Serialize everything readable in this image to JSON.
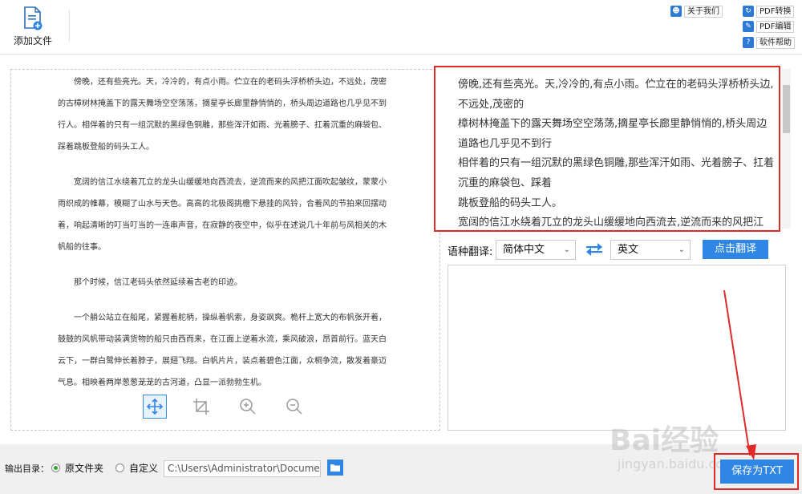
{
  "toolbar": {
    "add_file_label": "添加文件",
    "about_label": "关于我们",
    "pdf_convert_label": "PDF转换",
    "pdf_edit_label": "PDF编辑",
    "help_label": "软件帮助"
  },
  "preview": {
    "paragraphs": [
      "傍晚，还有些亮光。天，冷冷的，有点小雨。伫立在的老码头浮桥桥头边，不远处，茂密的古樟树林掩盖下的露天舞场空空荡荡，摘星亭长廊里静悄悄的，桥头周边道路也几乎见不到行人。相伴着的只有一组沉默的黑绿色铜雕，那些浑汗如雨、光着膀子、扛着沉重的麻袋包、踩着跳板登船的码头工人。",
      "宽阔的信江水绕着兀立的龙头山缓缓地向西流去，逆流而来的风把江面吹起皱纹，蒙蒙小雨织成的帷幕，模糊了山水与天色。高高的北极阁挑檐下悬挂的风铃，合着风的节拍来回摆动着，响起清晰的叮当叮当的一连串声音，在寂静的夜空中，似乎在述说几十年前与风相关的木帆船的往事。",
      "那个时候，信江老码头依然延续着古老的印迹。",
      "一个艄公站立在船尾，紧握着舵柄，操纵着帆索，身姿飒爽。桅杆上宽大的布帆张开着，鼓鼓的风帆带动装满货物的船只由西而来，在江面上逆着水流，乘风破浪，昂首前行。蓝天白云下，一群白鹭伸长着脖子，展翅飞翔。白帆片片，装点着碧色江面，众桐争流，散发着豪迈气息。相映着两岸葱葱茏茏的古河道，凸显一派勃勃生机。"
    ],
    "tools": [
      "move-tool",
      "crop-tool",
      "zoom-in-tool",
      "zoom-out-tool"
    ]
  },
  "result": {
    "lines": [
      "傍晚,还有些亮光。天,冷冷的,有点小雨。伫立在的老码头浮桥桥头边,不远处,茂密的",
      "樟树林掩盖下的露天舞场空空荡荡,摘星亭长廊里静悄悄的,桥头周边道路也几乎见不到行",
      "相伴着的只有一组沉默的黑绿色铜雕,那些浑汗如雨、光着膀子、扛着沉重的麻袋包、踩着",
      "跳板登船的码头工人。",
      "宽阔的信江水绕着兀立的龙头山缓缓地向西流去,逆流而来的风把江"
    ]
  },
  "translate": {
    "label": "语种翻译:",
    "source_lang": "简体中文",
    "target_lang": "英文",
    "button": "点击翻译"
  },
  "bottom": {
    "output_label": "输出目录：",
    "radio_original": "原文件夹",
    "radio_custom": "自定义",
    "path_value": "C:\\Users\\Administrator\\Documents",
    "save_button": "保存为TXT"
  },
  "watermark": {
    "text": "Bai经验",
    "sub": "jingyan.baidu.com"
  },
  "colors": {
    "accent": "#2f86e5",
    "highlight_red": "#e02a2a",
    "radio_checked": "#2aa52a"
  }
}
